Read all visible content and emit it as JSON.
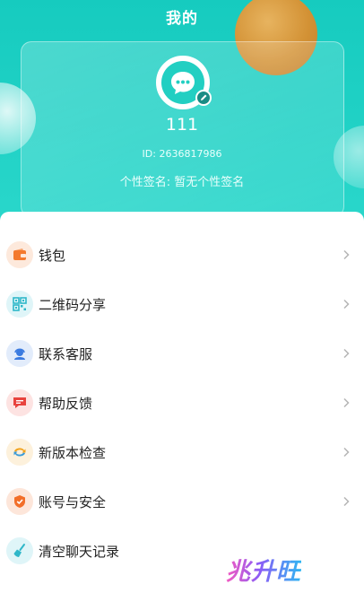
{
  "header": {
    "title": "我的"
  },
  "profile": {
    "avatar_icon": "chat-bubble-icon",
    "edit_icon": "pencil-icon",
    "nickname": "111",
    "id_text": "ID:  2636817986",
    "signature_text": "个性签名:  暂无个性签名"
  },
  "menu": {
    "items": [
      {
        "label": "钱包",
        "icon": "wallet-icon",
        "color": "#f47a2e",
        "bg": "#fde9dc"
      },
      {
        "label": "二维码分享",
        "icon": "qr-code-icon",
        "color": "#2fb7c9",
        "bg": "#dff5f8"
      },
      {
        "label": "联系客服",
        "icon": "customer-service-icon",
        "color": "#3b7be0",
        "bg": "#e2ecfb"
      },
      {
        "label": "帮助反馈",
        "icon": "feedback-icon",
        "color": "#e8433e",
        "bg": "#fde3e2"
      },
      {
        "label": "新版本检查",
        "icon": "update-icon",
        "color": "#f2a21b",
        "bg": "#fdf1dc"
      },
      {
        "label": "账号与安全",
        "icon": "shield-icon",
        "color": "#f26f2a",
        "bg": "#fde6da"
      },
      {
        "label": "清空聊天记录",
        "icon": "broom-icon",
        "color": "#2fb7c9",
        "bg": "#dff5f8"
      }
    ]
  },
  "watermark": {
    "text": "兆升旺"
  },
  "colors": {
    "primary": "#1ecbbf",
    "accent_orange": "#dd8f2e",
    "chevron": "#b5b5b5"
  }
}
